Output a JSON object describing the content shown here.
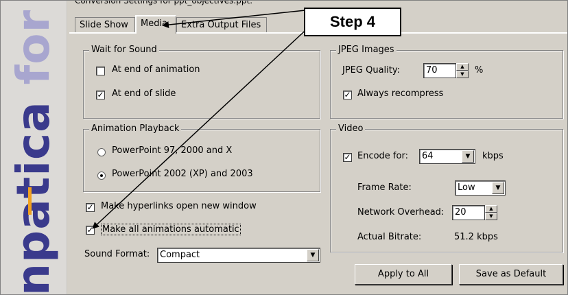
{
  "dialog": {
    "title": "Conversion Settings for ppt_objectives.ppt:"
  },
  "branding": {
    "text_part1": "npatica",
    "text_part2": " for Pow"
  },
  "tabs": [
    {
      "label": "Slide Show",
      "active": false
    },
    {
      "label": "Media",
      "active": true
    },
    {
      "label": "Extra Output Files",
      "active": false
    }
  ],
  "callout": {
    "label": "Step 4"
  },
  "wait_for_sound": {
    "legend": "Wait for Sound",
    "end_of_animation": {
      "label": "At end of animation",
      "checked": false
    },
    "end_of_slide": {
      "label": "At end of slide",
      "checked": true
    }
  },
  "animation_playback": {
    "legend": "Animation Playback",
    "option1": {
      "label": "PowerPoint 97, 2000 and X",
      "selected": false
    },
    "option2": {
      "label": "PowerPoint 2002 (XP) and 2003",
      "selected": true
    }
  },
  "hyperlinks": {
    "label": "Make hyperlinks open new window",
    "checked": true
  },
  "animations_auto": {
    "label": "Make all animations automatic",
    "checked": true
  },
  "sound_format": {
    "label": "Sound Format:",
    "value": "Compact"
  },
  "jpeg": {
    "legend": "JPEG Images",
    "quality_label": "JPEG Quality:",
    "quality_value": "70",
    "percent": "%",
    "recompress": {
      "label": "Always recompress",
      "checked": true
    }
  },
  "video": {
    "legend": "Video",
    "encode": {
      "label": "Encode for:",
      "checked": true,
      "value": "64",
      "unit": "kbps"
    },
    "frame_rate": {
      "label": "Frame Rate:",
      "value": "Low"
    },
    "network_overhead": {
      "label": "Network Overhead:",
      "value": "20"
    },
    "actual_bitrate": {
      "label": "Actual Bitrate:",
      "value": "51.2 kbps"
    }
  },
  "buttons": {
    "apply_all": "Apply to All",
    "save_default": "Save as Default"
  },
  "glyphs": {
    "check": "✓",
    "down": "▼",
    "up_small": "▲",
    "down_small": "▼"
  }
}
